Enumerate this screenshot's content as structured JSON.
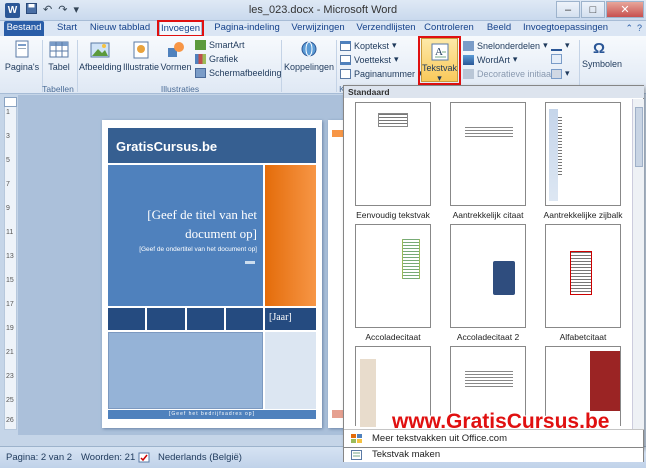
{
  "window": {
    "title": "les_023.docx  -  Microsoft Word",
    "app_icon": "W"
  },
  "qat": {
    "save_icon": "save-icon",
    "undo": "↶",
    "redo": "↷",
    "customize": "▾"
  },
  "window_buttons": {
    "minimize": "–",
    "maximize": "□",
    "close": "✕"
  },
  "tabs": [
    {
      "label": "Bestand"
    },
    {
      "label": "Start"
    },
    {
      "label": "Nieuw tabblad"
    },
    {
      "label": "Invoegen"
    },
    {
      "label": "Pagina-indeling"
    },
    {
      "label": "Verwijzingen"
    },
    {
      "label": "Verzendlijsten"
    },
    {
      "label": "Controleren"
    },
    {
      "label": "Beeld"
    },
    {
      "label": "Invoegtoepassingen"
    }
  ],
  "ribbon": {
    "paginas": "Pagina's",
    "tabel": "Tabel",
    "afbeelding": "Afbeelding",
    "illustratie": "Illustratie",
    "vormen": "Vormen",
    "smartart": "SmartArt",
    "grafiek": "Grafiek",
    "schermafbeelding": "Schermafbeelding",
    "koppelingen": "Koppelingen",
    "koptekst": "Koptekst",
    "voettekst": "Voettekst",
    "paginanummer": "Paginanummer",
    "tekstvak": "Tekstvak",
    "snelonderdelen": "Snelonderdelen",
    "wordart": "WordArt",
    "decoratieve": "Decoratieve initiaal",
    "symbolen": "Symbolen",
    "group_tabellen": "Tabellen",
    "group_illustraties": "Illustraties",
    "group_k": "K"
  },
  "document": {
    "brand": "GratisCursus.be",
    "title_placeholder": "[Geef de titel van het document op]",
    "subtitle_placeholder": "[Geef de ondertitel van het document op]",
    "year": "[Jaar]",
    "footer": "[Geef het bedrijfsadres op]"
  },
  "ruler_numbers": [
    "1",
    "2",
    "3",
    "4",
    "5",
    "6",
    "7",
    "8",
    "9",
    "10",
    "11",
    "12",
    "13",
    "14",
    "15",
    "16",
    "17",
    "18",
    "19",
    "20",
    "21",
    "22",
    "23",
    "24",
    "25",
    "26"
  ],
  "gallery": {
    "header": "Standaard",
    "items": [
      {
        "label": "Eenvoudig tekstvak"
      },
      {
        "label": "Aantrekkelijk citaat"
      },
      {
        "label": "Aantrekkelijke zijbalk"
      },
      {
        "label": "Accoladecitaat"
      },
      {
        "label": "Accoladecitaat 2"
      },
      {
        "label": "Alfabetcitaat"
      }
    ],
    "menu": [
      {
        "label": "Meer tekstvakken uit Office.com"
      },
      {
        "label": "Tekstvak maken"
      }
    ]
  },
  "status": {
    "page": "Pagina: 2 van 2",
    "words": "Woorden: 21",
    "language": "Nederlands (België)"
  },
  "watermark": "www.GratisCursus.be",
  "colors": {
    "accent_red": "#e01010",
    "file_tab": "#2a5ea8",
    "cover_blue": "#4f81bd",
    "cover_orange": "#f79646"
  }
}
